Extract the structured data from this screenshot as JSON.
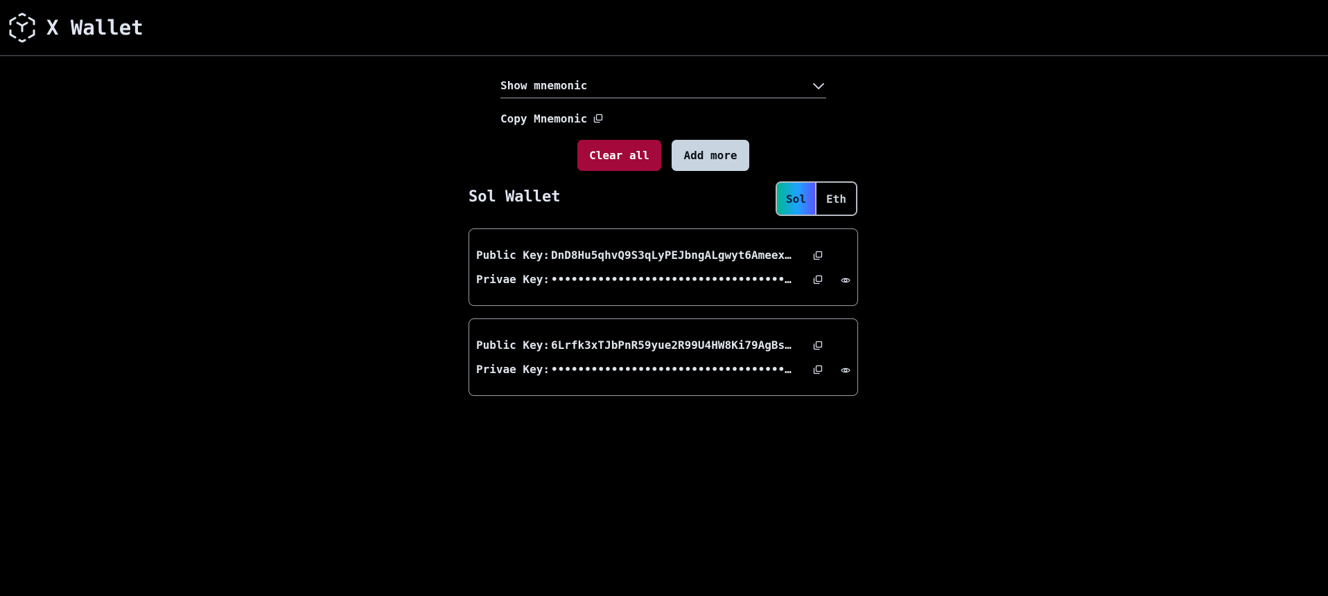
{
  "header": {
    "title": "X Wallet",
    "logo_icon": "hexagon-logo-icon"
  },
  "mnemonic": {
    "dropdown_label": "Show mnemonic",
    "copy_label": "Copy Mnemonic",
    "copy_icon": "copy-icon",
    "chevron_icon": "chevron-down-icon"
  },
  "actions": {
    "clear_label": "Clear all",
    "add_label": "Add more"
  },
  "wallet": {
    "heading": "Sol Wallet",
    "chain_options": [
      "Sol",
      "Eth"
    ],
    "selected_chain": "Sol",
    "public_key_label": "Public Key:",
    "private_key_label": "Privae Key:",
    "cards": [
      {
        "public_key": "DnD8Hu5qhvQ9S3qLyPEJbngALgwyt6Ameexmo…",
        "private_key": "••••••••••••••••••••••••••••••••••••••…"
      },
      {
        "public_key": "6Lrfk3xTJbPnR59yue2R99U4HW8Ki79AgBscJ…",
        "private_key": "••••••••••••••••••••••••••••••••••••••…"
      }
    ]
  },
  "colors": {
    "background": "#000000",
    "clear_button": "#a3093a",
    "add_button": "#c8d4e0",
    "toggle_gradient_start": "#00b894",
    "toggle_gradient_end": "#5a55ff"
  }
}
